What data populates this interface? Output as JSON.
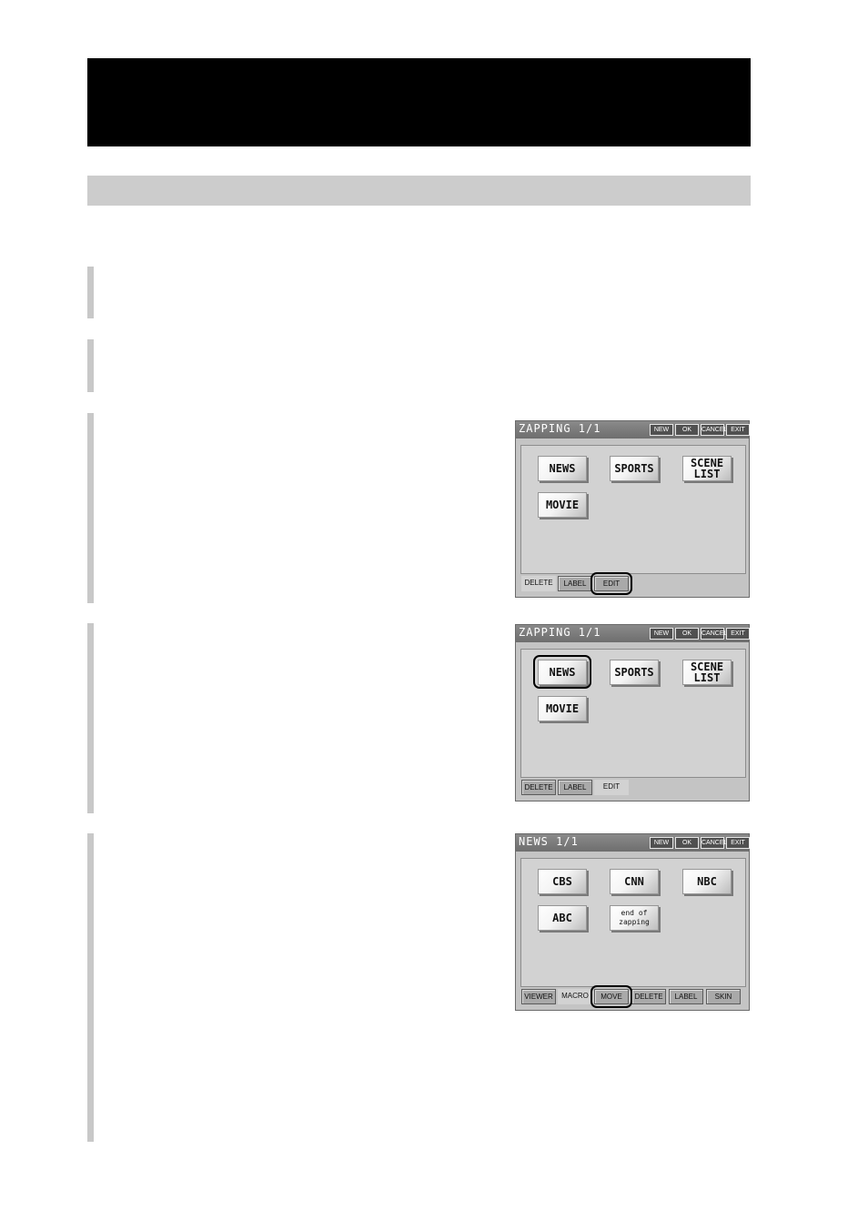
{
  "screens": [
    {
      "title": "ZAPPING 1/1",
      "header_buttons": [
        "NEW",
        "OK",
        "CANCEL",
        "EXIT"
      ],
      "keys": [
        "NEWS",
        "SPORTS",
        "SCENE\nLIST",
        "MOVIE"
      ],
      "tabs": [
        "DELETE",
        "LABEL",
        "EDIT"
      ],
      "highlight": "EDIT"
    },
    {
      "title": "ZAPPING 1/1",
      "header_buttons": [
        "NEW",
        "OK",
        "CANCEL",
        "EXIT"
      ],
      "keys": [
        "NEWS",
        "SPORTS",
        "SCENE\nLIST",
        "MOVIE"
      ],
      "tabs": [
        "DELETE",
        "LABEL",
        "EDIT"
      ],
      "highlight": "NEWS"
    },
    {
      "title": "NEWS 1/1",
      "header_buttons": [
        "NEW",
        "OK",
        "CANCEL",
        "EXIT"
      ],
      "keys": [
        "CBS",
        "CNN",
        "NBC",
        "ABC",
        "end of\nzapping"
      ],
      "tabs": [
        "VIEWER",
        "MACRO",
        "MOVE",
        "DELETE",
        "LABEL",
        "SKIN"
      ],
      "highlight": "MOVE"
    }
  ]
}
